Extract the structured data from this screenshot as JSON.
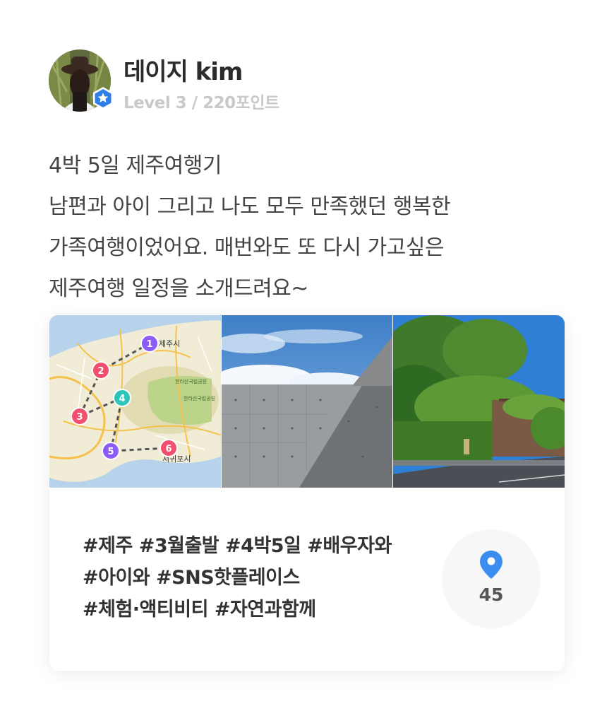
{
  "profile": {
    "name": "데이지 kim",
    "level": "Level 3 / 220포인트",
    "badge_icon": "star-badge-icon"
  },
  "post": {
    "lines": [
      "4박 5일 제주여행기",
      "남편과 아이 그리고 나도 모두 만족했던 행복한",
      "가족여행이었어요. 매번와도 또 다시 가고싶은",
      "제주여행 일정을 소개드려요~"
    ]
  },
  "card": {
    "map": {
      "labels": {
        "city_north": "제주시",
        "park_1": "한라산국립공원",
        "park_2": "한라산국립공원",
        "city_south": "서귀포시"
      },
      "markers": [
        "1",
        "2",
        "3",
        "4",
        "5",
        "6"
      ],
      "marker_colors": {
        "1": "#8b5cf6",
        "2": "#f0506e",
        "3": "#f0506e",
        "4": "#2ec4b6",
        "5": "#8b5cf6",
        "6": "#f0506e"
      }
    },
    "tags": [
      "#제주 #3월출발 #4박5일 #배우자와",
      "#아이와 #SNS핫플레이스",
      "#체험·액티비티 #자연과함께"
    ],
    "places": {
      "icon": "location-pin-icon",
      "count": "45",
      "color": "#3b8ef0"
    }
  }
}
